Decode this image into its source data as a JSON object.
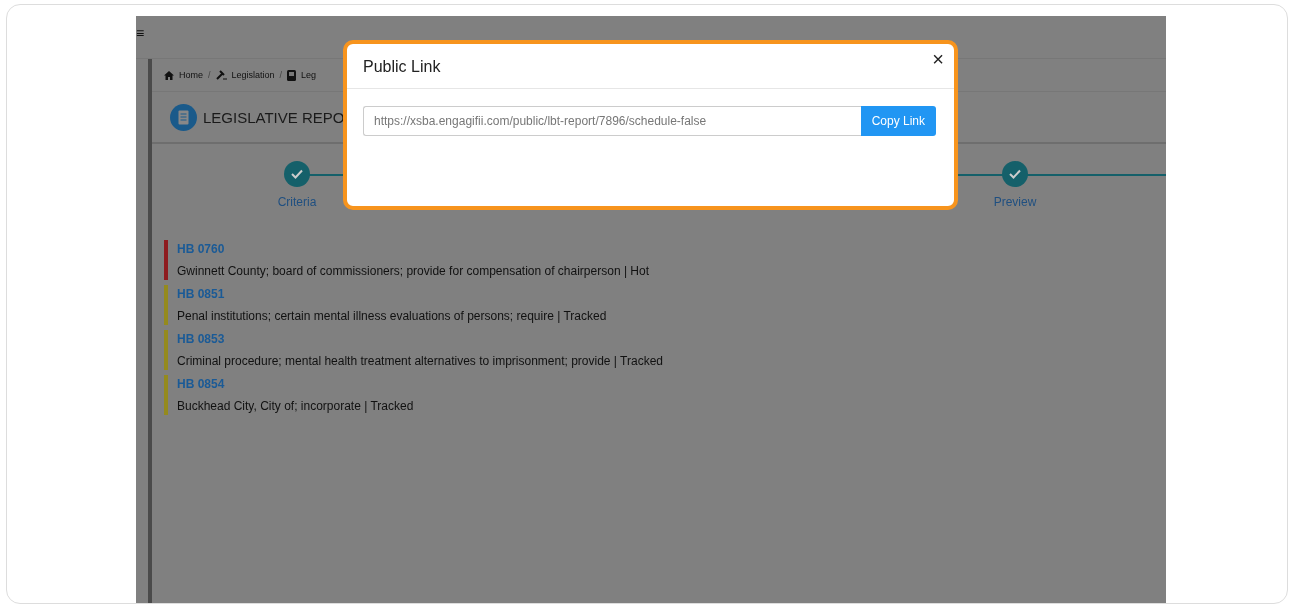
{
  "menu": "≡",
  "breadcrumb": {
    "items": [
      "Home",
      "Legislation",
      "Leg"
    ],
    "separator": "/"
  },
  "page_title": "LEGISLATIVE REPO",
  "steps": [
    {
      "label": "Criteria",
      "done": true
    },
    {
      "label": "Preview",
      "done": true
    }
  ],
  "bills": [
    {
      "number": "HB 0760",
      "description": "Gwinnett County; board of commissioners; provide for compensation of chairperson | Hot",
      "color": "#8e1b1f"
    },
    {
      "number": "HB 0851",
      "description": "Penal institutions; certain mental illness evaluations of persons; require | Tracked",
      "color": "#948a1e"
    },
    {
      "number": "HB 0853",
      "description": "Criminal procedure; mental health treatment alternatives to imprisonment; provide | Tracked",
      "color": "#948a1e"
    },
    {
      "number": "HB 0854",
      "description": "Buckhead City, City of; incorporate | Tracked",
      "color": "#948a1e"
    }
  ],
  "modal": {
    "title": "Public Link",
    "link_field": {
      "value": "https://xsba.engagifii.com/public/lbt-report/7896/schedule-false"
    },
    "copy_button": "Copy Link",
    "close": "×"
  }
}
